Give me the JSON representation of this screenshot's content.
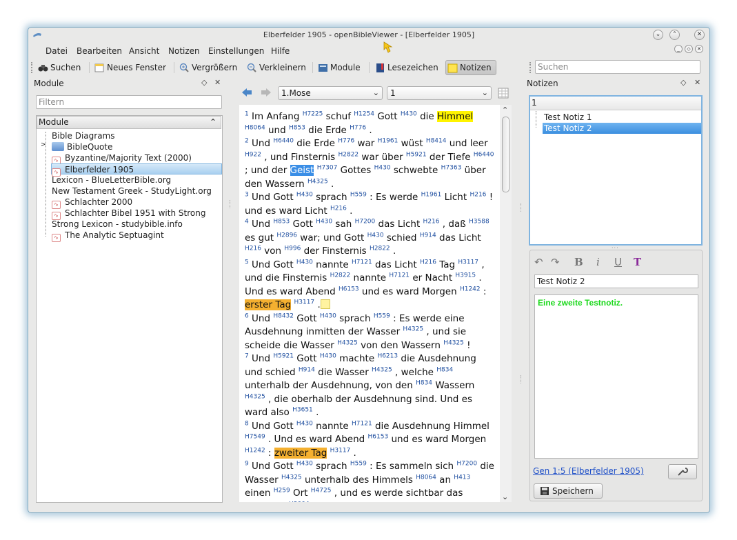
{
  "window": {
    "title": "Elberfelder 1905 - openBibleViewer - [Elberfelder 1905]"
  },
  "menu": [
    "Datei",
    "Bearbeiten",
    "Ansicht",
    "Notizen",
    "Einstellungen",
    "Hilfe"
  ],
  "toolbar": {
    "search": "Suchen",
    "new_window": "Neues Fenster",
    "zoom_in": "Vergrößern",
    "zoom_out": "Verkleinern",
    "modules": "Module",
    "bookmarks": "Lesezeichen",
    "notes": "Notizen",
    "search_placeholder": "Suchen"
  },
  "modules_dock": {
    "title": "Module",
    "filter_placeholder": "Filtern",
    "tree_header": "Module",
    "items": [
      {
        "label": "Bible Diagrams",
        "icon": "none"
      },
      {
        "label": "BibleQuote",
        "icon": "folder"
      },
      {
        "label": "Byzantine/Majority Text (2000)",
        "icon": "book"
      },
      {
        "label": "Elberfelder 1905",
        "icon": "book",
        "selected": true
      },
      {
        "label": "Lexicon - BlueLetterBible.org",
        "icon": "none"
      },
      {
        "label": "New Testament Greek - StudyLight.org",
        "icon": "none"
      },
      {
        "label": "Schlachter 2000",
        "icon": "book"
      },
      {
        "label": "Schlachter Bibel 1951 with Strong",
        "icon": "book"
      },
      {
        "label": "Strong Lexicon - studybible.info",
        "icon": "none"
      },
      {
        "label": "The Analytic Septuagint",
        "icon": "book"
      }
    ]
  },
  "reader": {
    "book": "1.Mose",
    "chapter": "1"
  },
  "notes_dock": {
    "title": "Notizen",
    "tree_header": "1",
    "notes": [
      "Test Notiz 1",
      "Test Notiz 2"
    ],
    "selected_note_title": "Test Notiz 2",
    "note_body": "Eine zweite Testnotiz.",
    "link": "Gen 1:5 (Elberfelder 1905)",
    "save": "Speichern",
    "format_buttons": [
      "B",
      "i",
      "U",
      "T"
    ]
  },
  "colors": {
    "highlight_yellow": "#fff400",
    "highlight_blue": "#3a8ee6",
    "highlight_orange": "#f4b030",
    "strong_link": "#1f4fa0",
    "note_text": "#1bd81b",
    "selection": "#a9d0f0"
  }
}
